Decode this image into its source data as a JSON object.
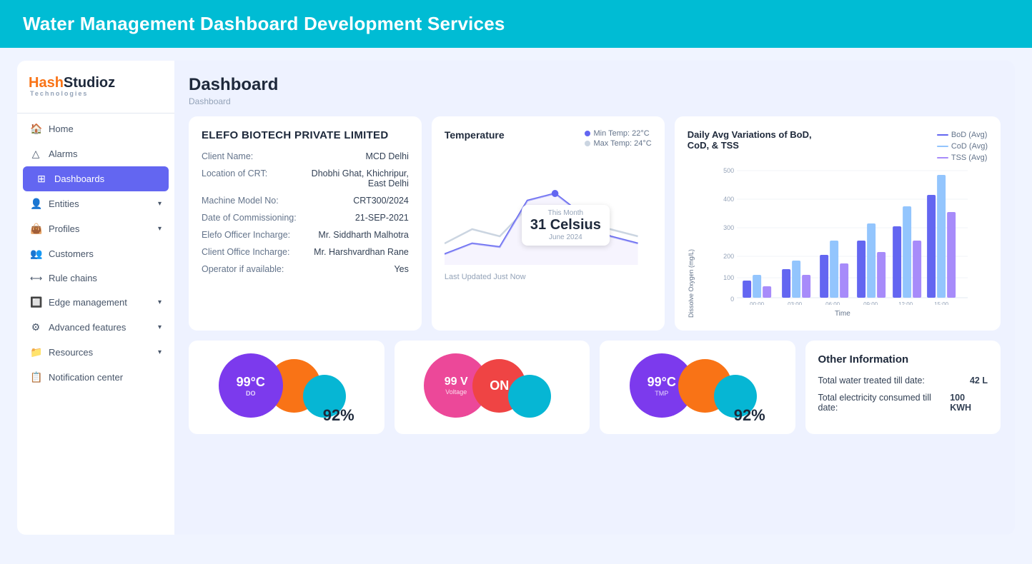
{
  "banner": {
    "title": "Water Management Dashboard Development Services"
  },
  "sidebar": {
    "logo": {
      "hash": "Hash",
      "studioz": "Studioz",
      "sub": "Technologies"
    },
    "items": [
      {
        "id": "home",
        "label": "Home",
        "icon": "🏠",
        "active": false
      },
      {
        "id": "alarms",
        "label": "Alarms",
        "icon": "🔔",
        "active": false
      },
      {
        "id": "dashboards",
        "label": "Dashboards",
        "icon": "⊞",
        "active": true
      },
      {
        "id": "entities",
        "label": "Entities",
        "icon": "👤",
        "active": false,
        "chevron": true
      },
      {
        "id": "profiles",
        "label": "Profiles",
        "icon": "👜",
        "active": false,
        "chevron": true
      },
      {
        "id": "customers",
        "label": "Customers",
        "icon": "👥",
        "active": false
      },
      {
        "id": "rule-chains",
        "label": "Rule chains",
        "icon": "⟷",
        "active": false
      },
      {
        "id": "edge-management",
        "label": "Edge management",
        "icon": "🔲",
        "active": false,
        "chevron": true
      },
      {
        "id": "advanced-features",
        "label": "Advanced features",
        "icon": "⚙",
        "active": false,
        "chevron": true
      },
      {
        "id": "resources",
        "label": "Resources",
        "icon": "📁",
        "active": false,
        "chevron": true
      },
      {
        "id": "notification-center",
        "label": "Notification center",
        "icon": "📋",
        "active": false
      }
    ]
  },
  "header": {
    "title": "Dashboard",
    "breadcrumb": "Dashboard"
  },
  "info_card": {
    "title": "Elefo Biotech Private Limited",
    "fields": [
      {
        "label": "Client Name:",
        "value": "MCD Delhi"
      },
      {
        "label": "Location of CRT:",
        "value": "Dhobhi Ghat, Khichripur, East Delhi"
      },
      {
        "label": "Machine Model No:",
        "value": "CRT300/2024"
      },
      {
        "label": "Date of Commissioning:",
        "value": "21-SEP-2021"
      },
      {
        "label": "Elefo Officer Incharge:",
        "value": "Mr. Siddharth Malhotra"
      },
      {
        "label": "Client Office Incharge:",
        "value": "Mr. Harshvardhan Rane"
      },
      {
        "label": "Operator if available:",
        "value": "Yes"
      }
    ]
  },
  "temperature_card": {
    "title": "Temperature",
    "legend": [
      {
        "label": "Min Temp: 22°C",
        "color": "#6366f1"
      },
      {
        "label": "Max Temp: 24°C",
        "color": "#cbd5e1"
      }
    ],
    "tooltip": {
      "month": "This Month",
      "value": "31 Celsius",
      "date": "June 2024"
    },
    "updated": "Last Updated Just Now"
  },
  "bod_chart": {
    "title": "Daily Avg Variations of BoD, CoD, & TSS",
    "y_label": "Dissolve Oxygen (mg/L)",
    "x_label": "Time",
    "legend": [
      {
        "label": "BoD (Avg)",
        "color": "#6366f1"
      },
      {
        "label": "CoD (Avg)",
        "color": "#93c5fd"
      },
      {
        "label": "TSS (Avg)",
        "color": "#a78bfa"
      }
    ],
    "x_ticks": [
      "00:00",
      "03:00",
      "06:00",
      "09:00",
      "12:00",
      "15:00"
    ],
    "y_ticks": [
      "0",
      "100",
      "200",
      "300",
      "400",
      "500"
    ],
    "bars": [
      {
        "time": "00:00",
        "bod": 60,
        "cod": 80,
        "tss": 40
      },
      {
        "time": "03:00",
        "bod": 100,
        "cod": 130,
        "tss": 80
      },
      {
        "time": "06:00",
        "bod": 150,
        "cod": 200,
        "tss": 120
      },
      {
        "time": "09:00",
        "bod": 200,
        "cod": 260,
        "tss": 160
      },
      {
        "time": "12:00",
        "bod": 250,
        "cod": 320,
        "tss": 200
      },
      {
        "time": "15:00",
        "bod": 360,
        "cod": 430,
        "tss": 300
      }
    ]
  },
  "gauges": [
    {
      "id": "do-gauge",
      "main_value": "99°C",
      "main_label": "DO",
      "main_color": "#7c3aed",
      "mid_color": "#f97316",
      "small_color": "#06b6d4",
      "percent": "92%"
    },
    {
      "id": "voltage-gauge",
      "main_value": "99 V",
      "main_label": "Voltage",
      "main_color": "#ec4899",
      "status": "ON",
      "mid_color": "#ef4444",
      "small_color": "#06b6d4"
    },
    {
      "id": "tmp-gauge",
      "main_value": "99°C",
      "main_label": "TMP",
      "main_color": "#7c3aed",
      "mid_color": "#f97316",
      "small_color": "#06b6d4",
      "percent": "92%"
    }
  ],
  "other_info": {
    "title": "Other Information",
    "items": [
      {
        "label": "Total water treated till date:",
        "value": "42 L"
      },
      {
        "label": "Total electricity consumed till date:",
        "value": "100 KWH"
      }
    ]
  }
}
